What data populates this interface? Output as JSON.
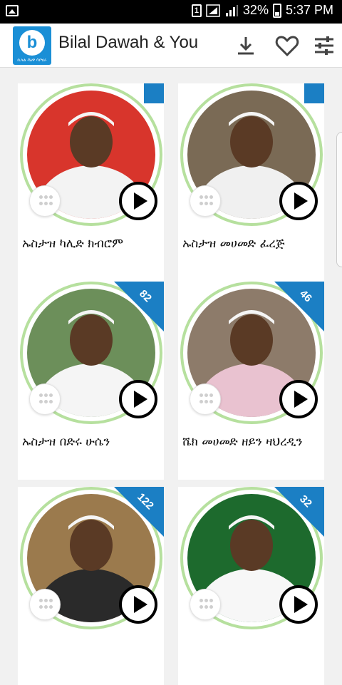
{
  "status_bar": {
    "sim": "1",
    "battery_percent": "32%",
    "time": "5:37 PM"
  },
  "app_bar": {
    "title": "Bilal Dawah & You",
    "logo_letter": "b",
    "logo_subtitle": "ቢላል ዳዕዋ ሳቦሄራ",
    "download_icon": "download-icon",
    "favorite_icon": "heart-outline-icon",
    "settings_icon": "sliders-icon"
  },
  "colors": {
    "accent": "#1b7fc4",
    "ring": "#b6e09e"
  },
  "cards": [
    {
      "name": "ኡስታዝ ካሊድ ክብሮም",
      "count": "",
      "photo_colors": [
        "#d8352c",
        "#f3f3f3"
      ]
    },
    {
      "name": "ኡስታዝ መሀመድ ፈረጅ",
      "count": "",
      "photo_colors": [
        "#7a6a55",
        "#f0f0f0"
      ]
    },
    {
      "name": "ኡስታዝ በድሩ ሁሴን",
      "count": "82",
      "photo_colors": [
        "#6c8f5a",
        "#f5f5f5"
      ]
    },
    {
      "name": "ሼክ መሀመድ ዘይን ዛህረዲን",
      "count": "46",
      "photo_colors": [
        "#8d7b6a",
        "#e9c2d0"
      ]
    },
    {
      "name": "",
      "count": "122",
      "photo_colors": [
        "#9b7a4d",
        "#2a2a2a"
      ]
    },
    {
      "name": "",
      "count": "32",
      "photo_colors": [
        "#1d6a2d",
        "#f7f7f7"
      ]
    }
  ]
}
